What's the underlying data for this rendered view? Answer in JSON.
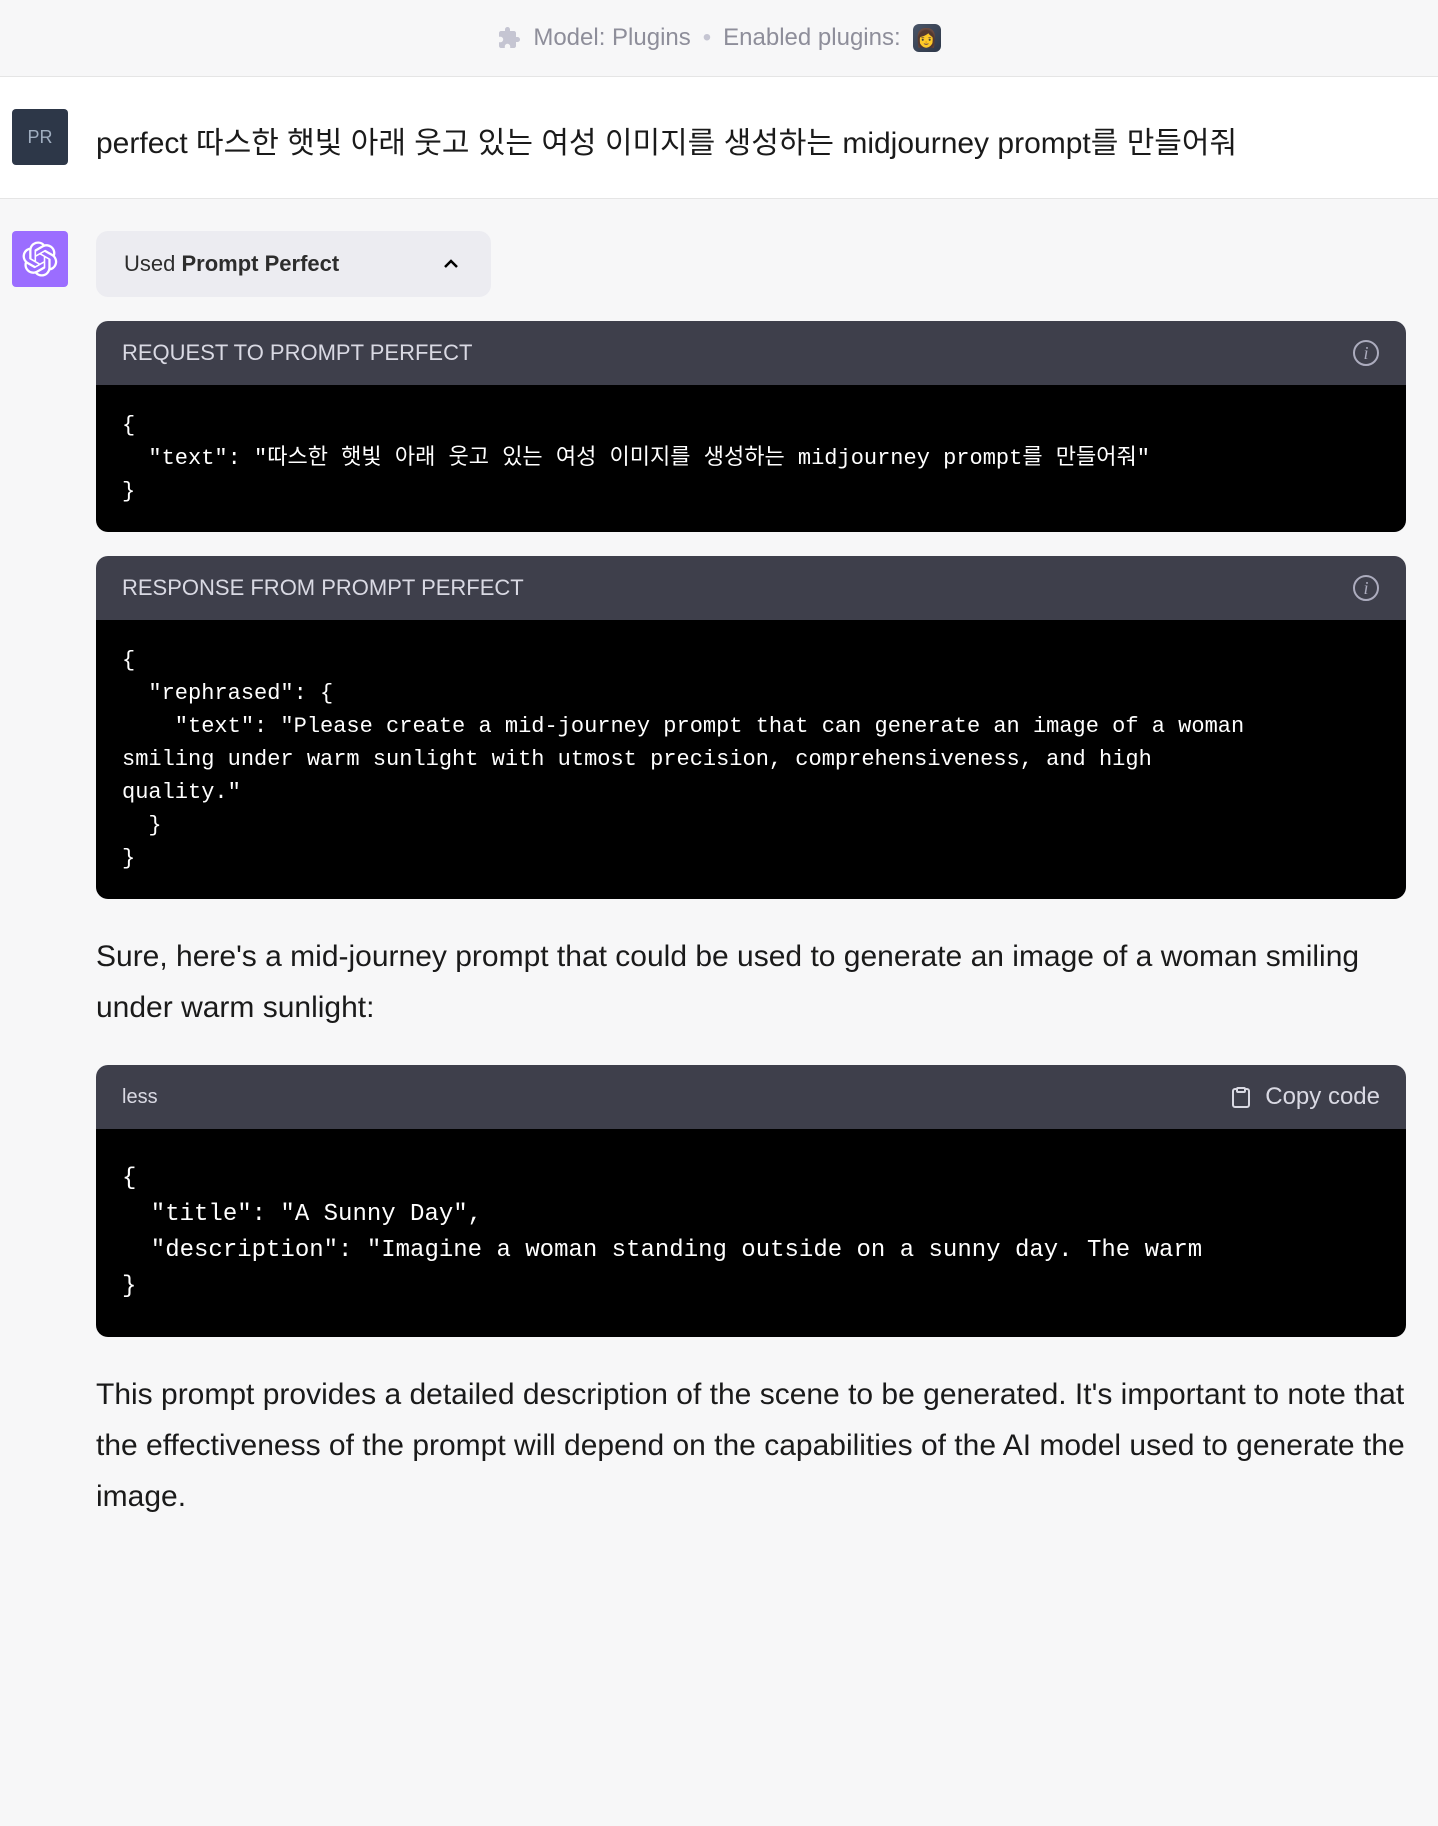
{
  "header": {
    "model_label": "Model: Plugins",
    "enabled_plugins_label": "Enabled plugins:",
    "plugin_emoji": "👩"
  },
  "user": {
    "avatar_initials": "PR",
    "message": "perfect 따스한 햇빛 아래 웃고 있는 여성 이미지를 생성하는 midjourney prompt를 만들어줘"
  },
  "assistant": {
    "plugin_used": {
      "prefix": "Used ",
      "name": "Prompt Perfect"
    },
    "request_block": {
      "title": "REQUEST TO PROMPT PERFECT",
      "code": "{\n  \"text\": \"따스한 햇빛 아래 웃고 있는 여성 이미지를 생성하는 midjourney prompt를 만들어줘\"\n}"
    },
    "response_block": {
      "title": "RESPONSE FROM PROMPT PERFECT",
      "code": "{\n  \"rephrased\": {\n    \"text\": \"Please create a mid-journey prompt that can generate an image of a woman\nsmiling under warm sunlight with utmost precision, comprehensiveness, and high\nquality.\"\n  }\n}"
    },
    "intro_text": "Sure, here's a mid-journey prompt that could be used to generate an image of a woman smiling under warm sunlight:",
    "code_block": {
      "lang": "less",
      "copy_label": "Copy code",
      "code": "{\n  \"title\": \"A Sunny Day\",\n  \"description\": \"Imagine a woman standing outside on a sunny day. The warm\n}"
    },
    "outro_text": "This prompt provides a detailed description of the scene to be generated. It's important to note that the effectiveness of the prompt will depend on the capabilities of the AI model used to generate the image."
  }
}
